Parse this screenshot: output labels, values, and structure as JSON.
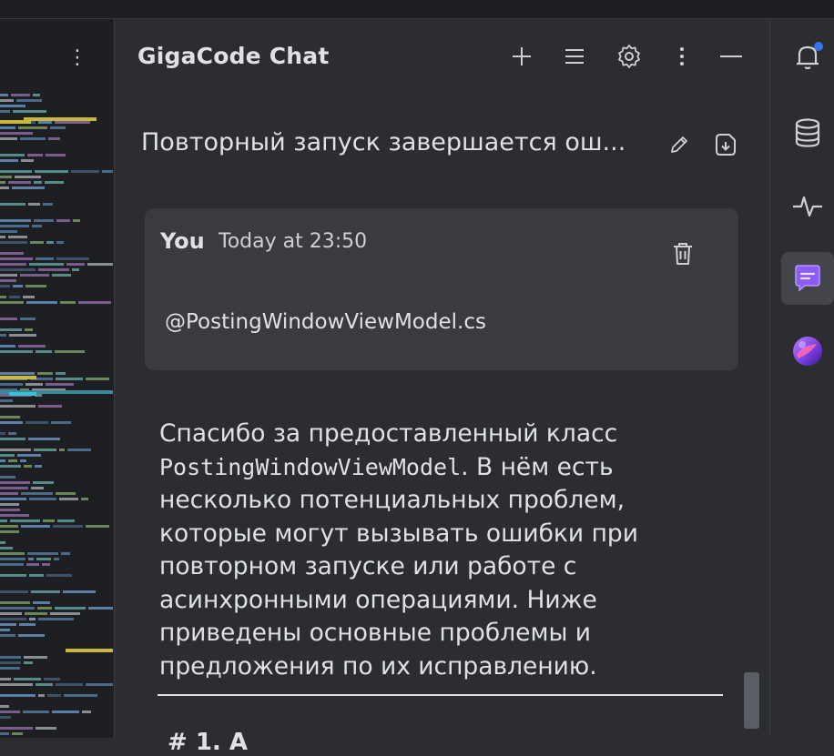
{
  "chat": {
    "title": "GigaCode Chat",
    "toolbar_icons": [
      "plus-icon",
      "list-icon",
      "gear-icon",
      "more-vertical-icon",
      "minimize-icon"
    ],
    "conversation_title": "Повторный запуск завершается ош...",
    "message": {
      "author": "You",
      "time": "Today at 23:50",
      "text": "@PostingWindowViewModel.cs"
    },
    "answer": {
      "before_code": "Спасибо за предоставленный класс ",
      "code": "PostingWindowViewModel",
      "after_code": ". В нём есть несколько потенциальных проблем, которые могут вызывать ошибки при повторном запуске или работе с асинхронными операциями. Ниже приведены основные проблемы и предложения по их исправлению.",
      "next_heading_partial": "# 1. А"
    }
  },
  "left_panel": {
    "more_icon": "more-vertical-icon"
  },
  "right_stripe": {
    "icons": [
      "notifications-icon",
      "database-icon",
      "activity-icon",
      "gigacode-chat-icon",
      "gigacode-logo-icon"
    ],
    "notification_dot_color": "#3574f0",
    "active_accent": "#8c5cf6"
  },
  "colors": {
    "background": "#2b2d30",
    "editor_background": "#1e1f22",
    "card": "#393b40",
    "text": "#dfe1e5"
  }
}
